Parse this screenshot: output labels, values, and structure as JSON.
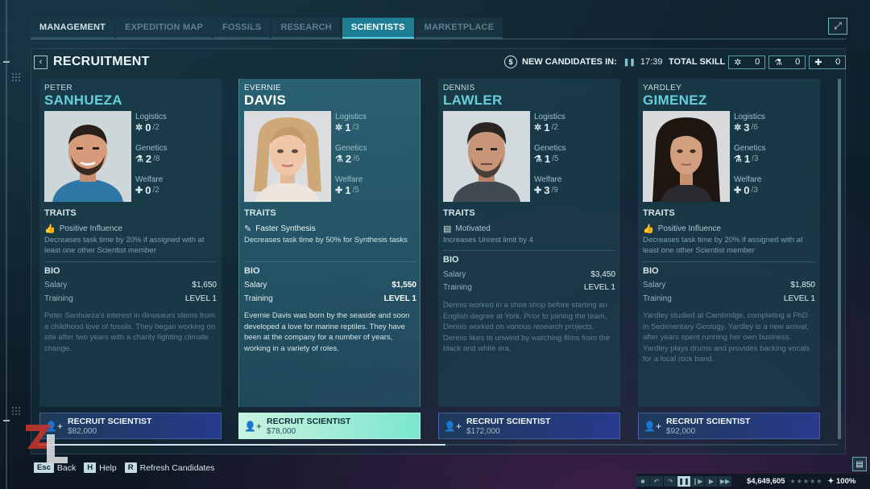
{
  "tabs": [
    {
      "label": "MANAGEMENT"
    },
    {
      "label": "EXPEDITION MAP"
    },
    {
      "label": "FOSSILS"
    },
    {
      "label": "RESEARCH"
    },
    {
      "label": "SCIENTISTS"
    },
    {
      "label": "MARKETPLACE"
    }
  ],
  "active_tab": "SCIENTISTS",
  "header": {
    "title": "RECRUITMENT",
    "new_candidates_label": "NEW CANDIDATES IN:",
    "new_candidates_timer": "17:39",
    "total_skill_label": "TOTAL SKILL",
    "total_skill": {
      "logistics": "0",
      "genetics": "0",
      "welfare": "0"
    }
  },
  "labels": {
    "logistics": "Logistics",
    "genetics": "Genetics",
    "welfare": "Welfare",
    "traits": "TRAITS",
    "bio": "BIO",
    "salary": "Salary",
    "training": "Training",
    "recruit": "RECRUIT SCIENTIST"
  },
  "candidates": [
    {
      "first_name": "PETER",
      "last_name": "SANHUEZA",
      "logistics": "0",
      "logistics_max": "/2",
      "genetics": "2",
      "genetics_max": "/8",
      "welfare": "0",
      "welfare_max": "/2",
      "trait_name": "Positive Influence",
      "trait_desc": "Decreases task time by 20% if assigned with at least one other Scientist member",
      "salary": "$1,650",
      "training": "LEVEL 1",
      "bio": "Peter Sanhueza's interest in dinosaurs stems from a childhood love of fossils. They began working on site after two years with a charity fighting climate change.",
      "recruit_price": "$82,000"
    },
    {
      "first_name": "EVERNIE",
      "last_name": "DAVIS",
      "logistics": "1",
      "logistics_max": "/3",
      "genetics": "2",
      "genetics_max": "/6",
      "welfare": "1",
      "welfare_max": "/5",
      "trait_name": "Faster Synthesis",
      "trait_desc": "Decreases task time by 50% for Synthesis tasks",
      "salary": "$1,550",
      "training": "LEVEL 1",
      "bio": "Evernie Davis was born by the seaside and soon developed a love for marine reptiles. They have been at the company for a number of years, working in a variety of roles.",
      "recruit_price": "$78,000"
    },
    {
      "first_name": "DENNIS",
      "last_name": "LAWLER",
      "logistics": "1",
      "logistics_max": "/2",
      "genetics": "1",
      "genetics_max": "/5",
      "welfare": "3",
      "welfare_max": "/9",
      "trait_name": "Motivated",
      "trait_desc": "Increases Unrest limit by 4",
      "salary": "$3,450",
      "training": "LEVEL 1",
      "bio": "Dennis worked in a shoe shop before starting an English degree at York. Prior to joining the team, Dennis worked on various research projects. Dennis likes to unwind by watching films from the black and white era.",
      "recruit_price": "$172,000"
    },
    {
      "first_name": "YARDLEY",
      "last_name": "GIMENEZ",
      "logistics": "3",
      "logistics_max": "/6",
      "genetics": "1",
      "genetics_max": "/3",
      "welfare": "0",
      "welfare_max": "/3",
      "trait_name": "Positive Influence",
      "trait_desc": "Decreases task time by 20% if assigned with at least one other Scientist member",
      "salary": "$1,850",
      "training": "LEVEL 1",
      "bio": "Yardley studied at Cambridge, completing a PhD in Sedimentary Geology. Yardley is a new arrival, after years spent running her own business. Yardley plays drums and provides backing vocals for a local rock band.",
      "recruit_price": "$92,000"
    }
  ],
  "footer": {
    "hints": [
      {
        "key": "Esc",
        "label": "Back"
      },
      {
        "key": "H",
        "label": "Help"
      },
      {
        "key": "R",
        "label": "Refresh Candidates"
      }
    ],
    "money": "$4,649,605",
    "approval": "100%"
  }
}
